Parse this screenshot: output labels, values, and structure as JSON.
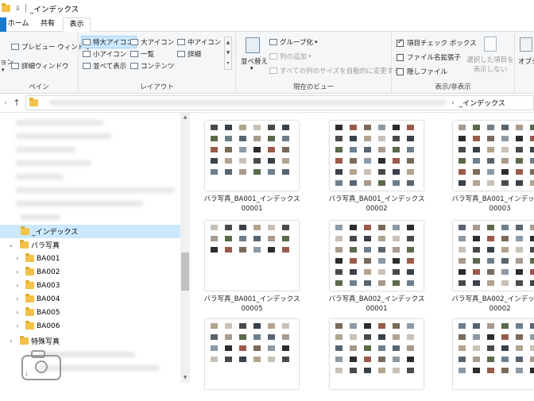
{
  "window": {
    "title": "_インデックス",
    "qa_arrow": "⇩"
  },
  "tabs": [
    {
      "label": "ホーム"
    },
    {
      "label": "共有"
    },
    {
      "label": "表示"
    }
  ],
  "ribbon": {
    "pane_group": {
      "label": "ペイン",
      "nav_cut": "ョン",
      "preview": "プレビュー ウィンドウ",
      "details": "詳細ウィンドウ"
    },
    "layout_group": {
      "label": "レイアウト",
      "items": [
        "特大アイコン",
        "大アイコン",
        "中アイコン",
        "小アイコン",
        "一覧",
        "詳細",
        "並べて表示",
        "コンテンツ"
      ]
    },
    "view_group": {
      "label": "現在のビュー",
      "sort": "並べ替え",
      "group": "グループ化",
      "add_col": "列の追加",
      "fit_cols": "すべての列のサイズを自動的に変更する"
    },
    "showhide_group": {
      "label": "表示/非表示",
      "checks": [
        {
          "label": "項目チェック ボックス",
          "checked": true
        },
        {
          "label": "ファイル名拡張子",
          "checked": false
        },
        {
          "label": "隠しファイル",
          "checked": false
        }
      ],
      "hide_sel_line1": "選択した項目を",
      "hide_sel_line2": "表示しない",
      "options_cut": "オプシ"
    }
  },
  "address": {
    "current": "_インデックス",
    "separator": "›"
  },
  "nav_tree": {
    "selected": "_インデックス",
    "photos_folder": "バラ写真",
    "subfolders": [
      "BA001",
      "BA002",
      "BA003",
      "BA004",
      "BA005",
      "BA006"
    ],
    "special": "特殊写真"
  },
  "files": [
    {
      "line1": "バラ写真_BA001_インデックス",
      "line2": "00001",
      "cols": 6,
      "rows": 5
    },
    {
      "line1": "バラ写真_BA001_インデックス",
      "line2": "00002",
      "cols": 6,
      "rows": 6
    },
    {
      "line1": "バラ写真_BA001_インデックス",
      "line2": "00003",
      "cols": 6,
      "rows": 6
    },
    {
      "line1": "バラ写真_BA001_インデックス",
      "line2": "00005",
      "cols": 6,
      "rows": 3
    },
    {
      "line1": "バラ写真_BA002_インデックス",
      "line2": "00001",
      "cols": 6,
      "rows": 6
    },
    {
      "line1": "バラ写真_BA002_インデックス",
      "line2": "00002",
      "cols": 6,
      "rows": 6
    },
    {
      "line1": "",
      "line2": "",
      "cols": 6,
      "rows": 4
    },
    {
      "line1": "",
      "line2": "",
      "cols": 6,
      "rows": 5
    },
    {
      "line1": "",
      "line2": "",
      "cols": 6,
      "rows": 5
    }
  ],
  "colors": {
    "accent": "#1979ca",
    "folder": "#f2c249",
    "selection": "#cce8ff"
  }
}
